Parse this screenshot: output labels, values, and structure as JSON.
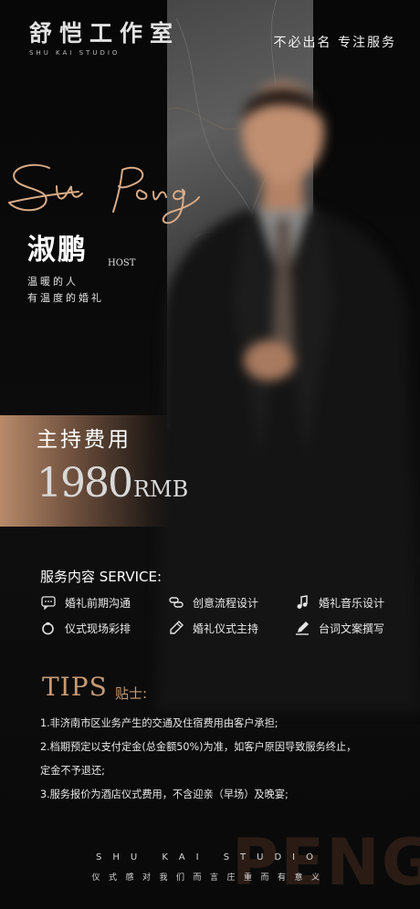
{
  "brand": {
    "logo_cn": "舒恺工作室",
    "logo_en": "SHU KAI STUDIO"
  },
  "slogan": "不必出名  专注服务",
  "host": {
    "script_name": "Su Peng",
    "name_cn": "淑鹏",
    "role": "HOST",
    "tagline_1": "温暖的人",
    "tagline_2": "有温度的婚礼"
  },
  "fee": {
    "title": "主持费用",
    "amount": "1980",
    "unit": "RMB"
  },
  "services": {
    "title": "服务内容 SERVICE:",
    "items": [
      {
        "label": "婚礼前期沟通",
        "icon": "chat-icon"
      },
      {
        "label": "创意流程设计",
        "icon": "link-icon"
      },
      {
        "label": "婚礼音乐设计",
        "icon": "music-note-icon"
      },
      {
        "label": "仪式现场彩排",
        "icon": "ring-icon"
      },
      {
        "label": "婚礼仪式主持",
        "icon": "pen-icon"
      },
      {
        "label": "台词文案撰写",
        "icon": "edit-icon"
      }
    ]
  },
  "tips": {
    "title_en": "TIPS",
    "title_cn": "贴士:",
    "notes": [
      "1.非济南市区业务产生的交通及住宿费用由客户承担;",
      "2.档期预定以支付定金(总金额50%)为准，如客户原因导致服务终止，",
      "定金不予退还;",
      "3.服务报价为酒店仪式费用，不含迎亲（早场）及晚宴;"
    ]
  },
  "watermark": "PENG",
  "footer": {
    "studio": "SHU KAI STUDIO",
    "motto": "仪式感对我们而言庄重而有意义"
  },
  "colors": {
    "accent_gold": "#c79a74",
    "background": "#0b0b0b"
  }
}
